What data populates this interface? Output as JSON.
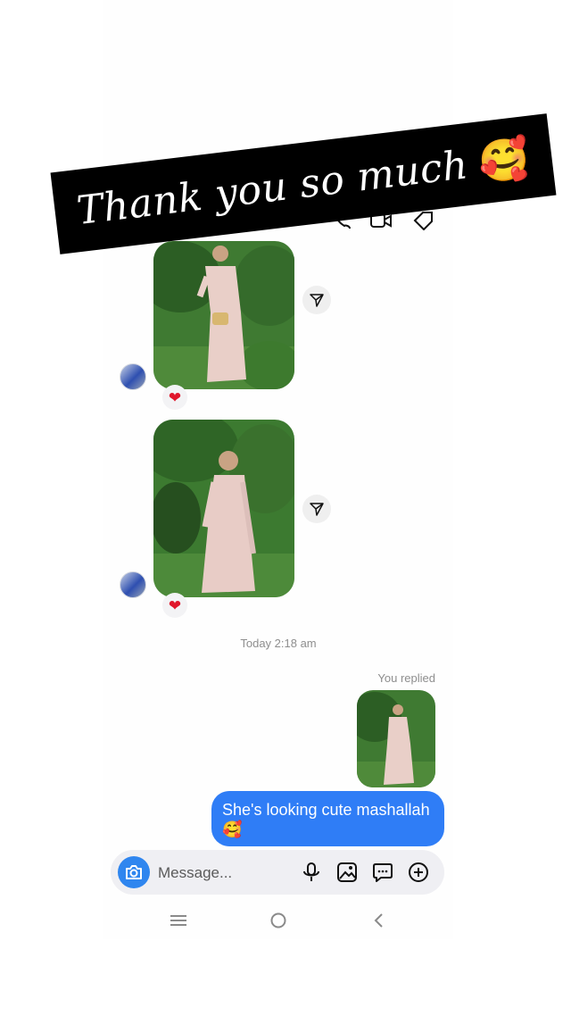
{
  "overlay": {
    "caption": "Thank you so much",
    "emoji": "🥰"
  },
  "thread": {
    "received": [
      {
        "reaction": "❤"
      },
      {
        "reaction": "❤"
      }
    ],
    "timestamp": "Today 2:18 am",
    "reply_label": "You replied",
    "sent_message": "She's looking cute mashallah 🥰"
  },
  "composer": {
    "placeholder": "Message..."
  },
  "icons": {
    "camera": "camera-icon",
    "mic": "microphone-icon",
    "gallery": "gallery-icon",
    "sticker": "sticker-chat-icon",
    "add": "plus-circle-icon",
    "share": "paper-plane-icon",
    "nav_menu": "menu-icon",
    "nav_home": "home-circle-icon",
    "nav_back": "back-chevron-icon"
  },
  "colors": {
    "accent": "#2f7df6",
    "camera": "#2f86ef",
    "heart": "#e0162b",
    "meta_text": "#8e8e8e"
  }
}
